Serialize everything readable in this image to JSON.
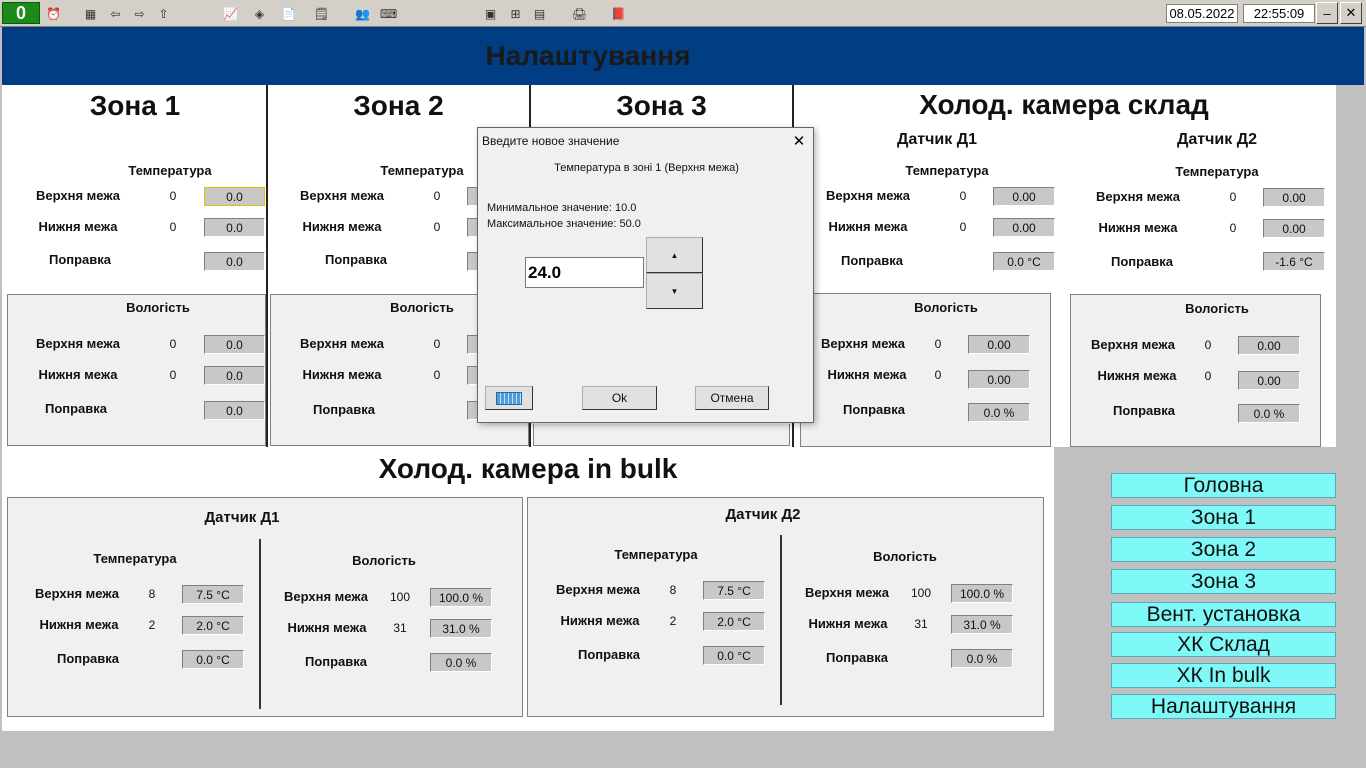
{
  "toolbar": {
    "counter": "0",
    "date": "08.05.2022",
    "time": "22:55:09",
    "minimize": "–",
    "close": "✕"
  },
  "header": {
    "title": "Налаштування"
  },
  "zones": [
    {
      "title": "Зона 1",
      "temp_label": "Температура",
      "upper": "Верхня межа",
      "upper_num": "0",
      "upper_val": "0.0",
      "lower": "Нижня межа",
      "lower_num": "0",
      "lower_val": "0.0",
      "corr": "Поправка",
      "corr_val": "0.0",
      "hum_label": "Вологість",
      "h_upper": "Верхня межа",
      "h_upper_num": "0",
      "h_upper_val": "0.0",
      "h_lower": "Нижня межа",
      "h_lower_num": "0",
      "h_lower_val": "0.0",
      "h_corr": "Поправка",
      "h_corr_val": "0.0"
    },
    {
      "title": "Зона 2",
      "temp_label": "Температура",
      "upper": "Верхня межа",
      "upper_num": "0",
      "lower": "Нижня межа",
      "lower_num": "0",
      "corr": "Поправка",
      "hum_label": "Вологість",
      "h_upper": "Верхня межа",
      "h_upper_num": "0",
      "h_lower": "Нижня межа",
      "h_lower_num": "0",
      "h_corr": "Поправка"
    },
    {
      "title": "Зона 3"
    }
  ],
  "cold_sklad": {
    "title": "Холод. камера склад",
    "d1": {
      "title": "Датчик Д1",
      "temp_label": "Температура",
      "upper": "Верхня межа",
      "upper_num": "0",
      "upper_val": "0.00",
      "lower": "Нижня межа",
      "lower_num": "0",
      "lower_val": "0.00",
      "corr": "Поправка",
      "corr_val": "0.0 °C",
      "hum_label": "Вологість",
      "h_upper": "Верхня межа",
      "h_upper_num": "0",
      "h_upper_val": "0.00",
      "h_lower": "Нижня межа",
      "h_lower_num": "0",
      "h_lower_val": "0.00",
      "h_corr": "Поправка",
      "h_corr_val": "0.0 %"
    },
    "d2": {
      "title": "Датчик Д2",
      "temp_label": "Температура",
      "upper": "Верхня межа",
      "upper_num": "0",
      "upper_val": "0.00",
      "lower": "Нижня межа",
      "lower_num": "0",
      "lower_val": "0.00",
      "corr": "Поправка",
      "corr_val": "-1.6 °C",
      "hum_label": "Вологість",
      "h_upper": "Верхня межа",
      "h_upper_num": "0",
      "h_upper_val": "0.00",
      "h_lower": "Нижня межа",
      "h_lower_num": "0",
      "h_lower_val": "0.00",
      "h_corr": "Поправка",
      "h_corr_val": "0.0 %"
    }
  },
  "cold_bulk": {
    "title": "Холод. камера in bulk",
    "d1": {
      "title": "Датчик Д1",
      "temp_label": "Температура",
      "upper": "Верхня межа",
      "upper_num": "8",
      "upper_val": "7.5 °C",
      "lower": "Нижня межа",
      "lower_num": "2",
      "lower_val": "2.0 °C",
      "corr": "Поправка",
      "corr_val": "0.0 °C",
      "hum_label": "Вологість",
      "h_upper": "Верхня межа",
      "h_upper_num": "100",
      "h_upper_val": "100.0 %",
      "h_lower": "Нижня межа",
      "h_lower_num": "31",
      "h_lower_val": "31.0 %",
      "h_corr": "Поправка",
      "h_corr_val": "0.0 %"
    },
    "d2": {
      "title": "Датчик Д2",
      "temp_label": "Температура",
      "upper": "Верхня межа",
      "upper_num": "8",
      "upper_val": "7.5 °C",
      "lower": "Нижня межа",
      "lower_num": "2",
      "lower_val": "2.0 °C",
      "corr": "Поправка",
      "corr_val": "0.0 °C",
      "hum_label": "Вологість",
      "h_upper": "Верхня межа",
      "h_upper_num": "100",
      "h_upper_val": "100.0 %",
      "h_lower": "Нижня межа",
      "h_lower_num": "31",
      "h_lower_val": "31.0 %",
      "h_corr": "Поправка",
      "h_corr_val": "0.0 %"
    }
  },
  "nav": [
    "Головна",
    "Зона 1",
    "Зона 2",
    "Зона 3",
    "Вент. установка",
    "ХК Склад",
    "ХК In bulk",
    "Налаштування"
  ],
  "dialog": {
    "title": "Введите новое значение",
    "subtitle": "Температура в зоні 1 (Верхня межа)",
    "min": "Минимальное значение: 10.0",
    "max": "Максимальное значение: 50.0",
    "value": "24.0",
    "ok": "Ok",
    "cancel": "Отмена",
    "close": "✕",
    "up": "▲",
    "down": "▼"
  }
}
